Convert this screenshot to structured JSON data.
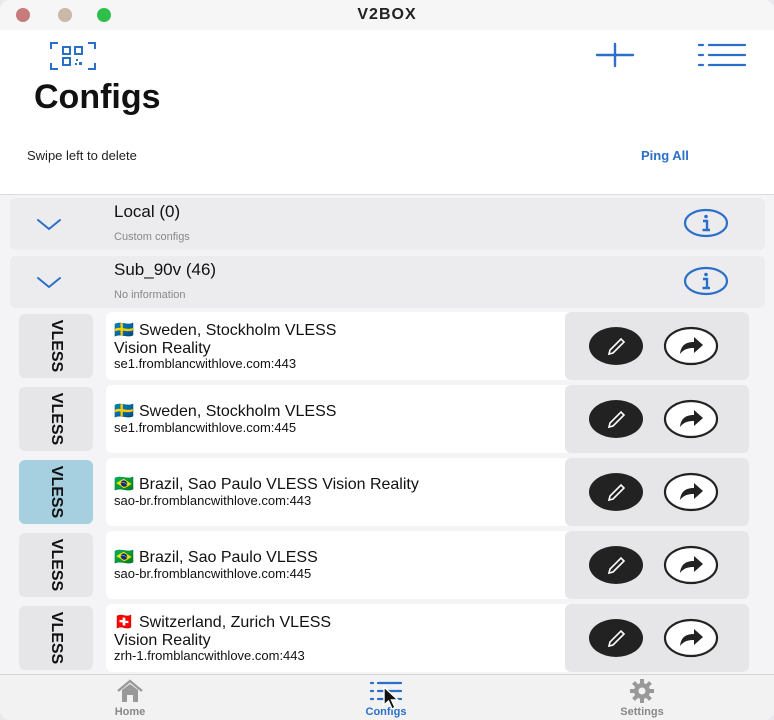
{
  "window": {
    "title": "V2BOX"
  },
  "header": {
    "title": "Configs",
    "hint": "Swipe left to delete",
    "ping_all": "Ping All"
  },
  "groups": [
    {
      "name": "Local (0)",
      "subtitle": "Custom configs"
    },
    {
      "name": "Sub_90v (46)",
      "subtitle": "No information"
    }
  ],
  "configs": [
    {
      "protocol": "VLESS",
      "flag": "🇸🇪",
      "name": "Sweden, Stockholm VLESS",
      "name_line2": "Vision Reality",
      "address": "se1.fromblancwithlove.com:443",
      "selected": false
    },
    {
      "protocol": "VLESS",
      "flag": "🇸🇪",
      "name": "Sweden, Stockholm VLESS",
      "name_line2": "",
      "address": "se1.fromblancwithlove.com:445",
      "selected": false
    },
    {
      "protocol": "VLESS",
      "flag": "🇧🇷",
      "name": "Brazil, Sao Paulo VLESS Vision Reality",
      "name_line2": "",
      "address": "sao-br.fromblancwithlove.com:443",
      "selected": true
    },
    {
      "protocol": "VLESS",
      "flag": "🇧🇷",
      "name": "Brazil, Sao Paulo VLESS",
      "name_line2": "",
      "address": "sao-br.fromblancwithlove.com:445",
      "selected": false
    },
    {
      "protocol": "VLESS",
      "flag": "🇨🇭",
      "name": "Switzerland, Zurich VLESS",
      "name_line2": "Vision Reality",
      "address": "zrh-1.fromblancwithlove.com:443",
      "selected": false
    }
  ],
  "tabbar": {
    "items": [
      {
        "label": "Home",
        "icon": "home-icon"
      },
      {
        "label": "Configs",
        "icon": "list-icon"
      },
      {
        "label": "Settings",
        "icon": "gear-icon"
      }
    ],
    "active": "Configs"
  },
  "colors": {
    "accent": "#2a6fc8",
    "selected_protocol": "#a6d0df"
  }
}
